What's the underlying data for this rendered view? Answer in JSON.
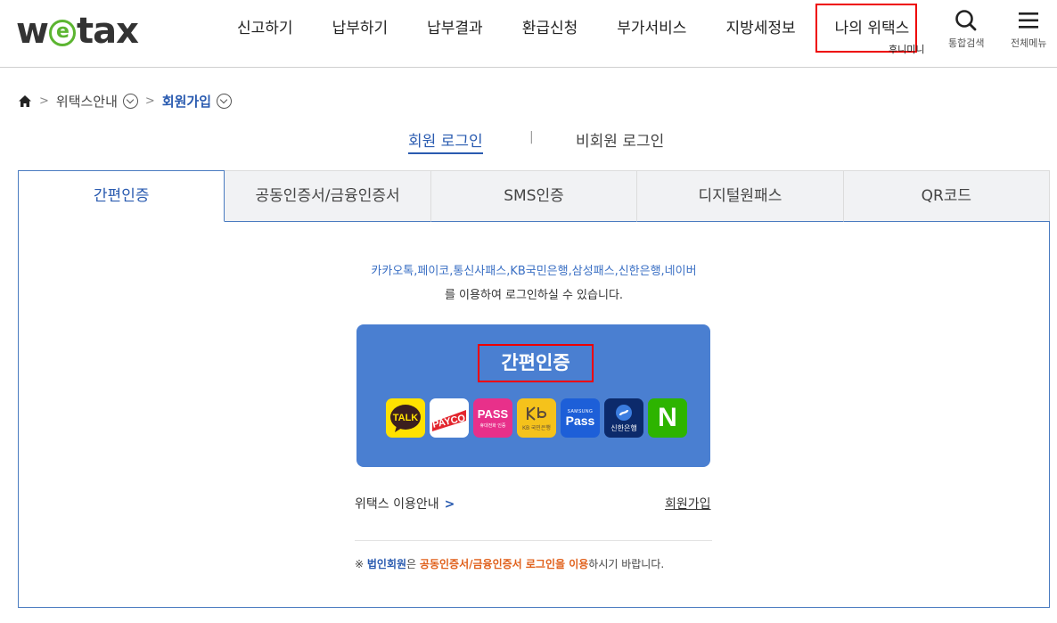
{
  "brand": {
    "logo_pre": "w",
    "logo_e": "e",
    "logo_post": "tax"
  },
  "nav": {
    "items": [
      "신고하기",
      "납부하기",
      "납부결과",
      "환급신청",
      "부가서비스",
      "지방세정보",
      "나의 위택스"
    ],
    "sub_tip": "후니미니",
    "search_label": "통합검색",
    "menu_label": "전체메뉴"
  },
  "breadcrumb": {
    "level1": "위택스안내",
    "current": "회원가입"
  },
  "login_tabs": {
    "member": "회원 로그인",
    "separator": "|",
    "nonmember": "비회원 로그인"
  },
  "auth_tabs": [
    "간편인증",
    "공동인증서/금융인증서",
    "SMS인증",
    "디지털원패스",
    "QR코드"
  ],
  "panel": {
    "providers_text": "카카오톡,페이코,통신사패스,KB국민은행,삼성패스,신한은행,네이버",
    "usage_text": "를 이용하여 로그인하실 수 있습니다.",
    "cert_title": "간편인증",
    "apps": [
      {
        "name": "kakaotalk",
        "label": "TALK",
        "bg": "#ffe100",
        "fg": "#3b1e1e"
      },
      {
        "name": "payco",
        "label": "PAYCO",
        "bg": "#ffffff",
        "fg": "#e3262e"
      },
      {
        "name": "pass",
        "label": "PASS",
        "sub": "휴대전화 인증",
        "bg": "#e8308a",
        "fg": "#ffffff"
      },
      {
        "name": "kb",
        "label": "KB 국민은행",
        "bg": "#f5c21b",
        "fg": "#5a4a3a"
      },
      {
        "name": "samsung-pass",
        "label": "Pass",
        "sub": "SAMSUNG",
        "bg": "#1d5fd8",
        "fg": "#ffffff"
      },
      {
        "name": "shinhan",
        "label": "신한은행",
        "bg": "#0c2a6b",
        "fg": "#ffffff"
      },
      {
        "name": "naver",
        "label": "N",
        "bg": "#2db400",
        "fg": "#ffffff"
      }
    ],
    "guide_link": "위택스 이용안내",
    "signup_link": "회원가입",
    "note_prefix": "※ ",
    "note_corp": "법인회원",
    "note_mid": "은 ",
    "note_method": "공동인증서/금융인증서 로그인을 이용",
    "note_suffix": "하시기 바랍니다."
  },
  "colors": {
    "accent": "#2a5bb0",
    "panel_border": "#4a7bc0",
    "cert_bg": "#4a7fd1",
    "highlight": "#ee0000",
    "logo_green": "#5cb531"
  }
}
